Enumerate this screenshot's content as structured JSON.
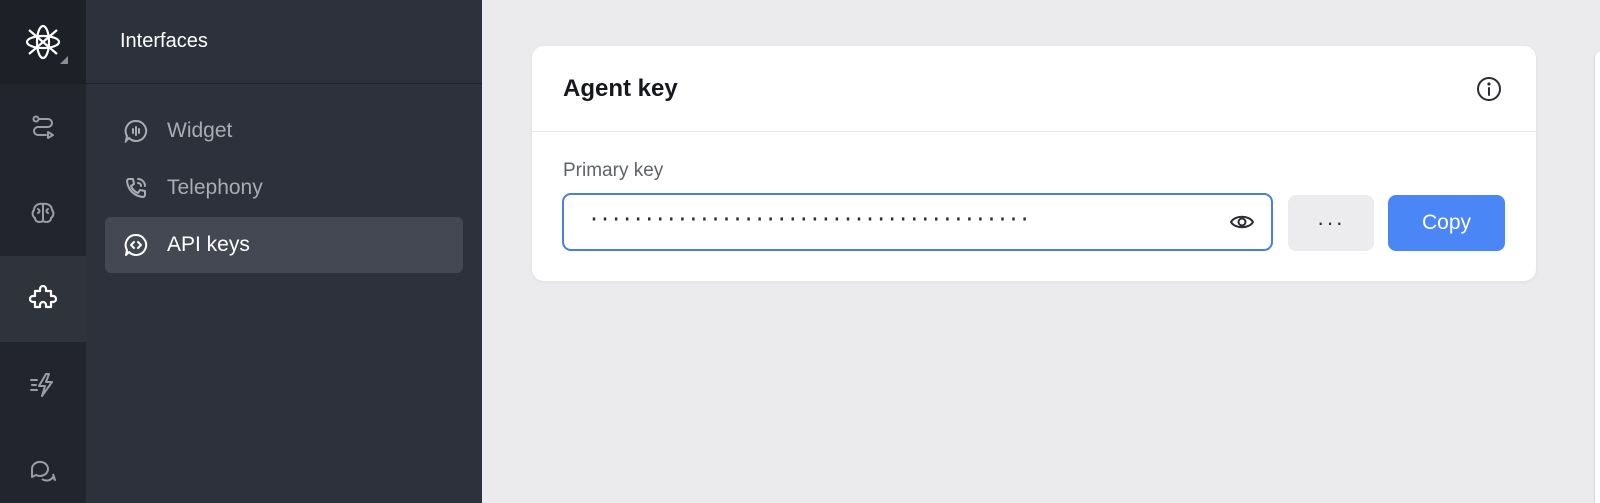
{
  "sidebar": {
    "title": "Interfaces",
    "items": [
      {
        "label": "Widget",
        "icon": "chat-waveform-icon",
        "active": false
      },
      {
        "label": "Telephony",
        "icon": "phone-call-icon",
        "active": false
      },
      {
        "label": "API keys",
        "icon": "code-chat-icon",
        "active": true
      }
    ]
  },
  "rail": {
    "items": [
      {
        "icon": "flow-icon",
        "active": false
      },
      {
        "icon": "brain-icon",
        "active": false
      },
      {
        "icon": "puzzle-icon",
        "active": true
      },
      {
        "icon": "lightning-icon",
        "active": false
      },
      {
        "icon": "conversation-icon",
        "active": false
      }
    ]
  },
  "card": {
    "title": "Agent key",
    "field_label": "Primary key",
    "key_masked": "········································",
    "more_label": "···",
    "copy_label": "Copy"
  },
  "colors": {
    "accent": "#4a86f6",
    "focus_border": "#4a7fe0",
    "sidebar_bg": "#2d313b",
    "rail_bg": "#22252d"
  }
}
